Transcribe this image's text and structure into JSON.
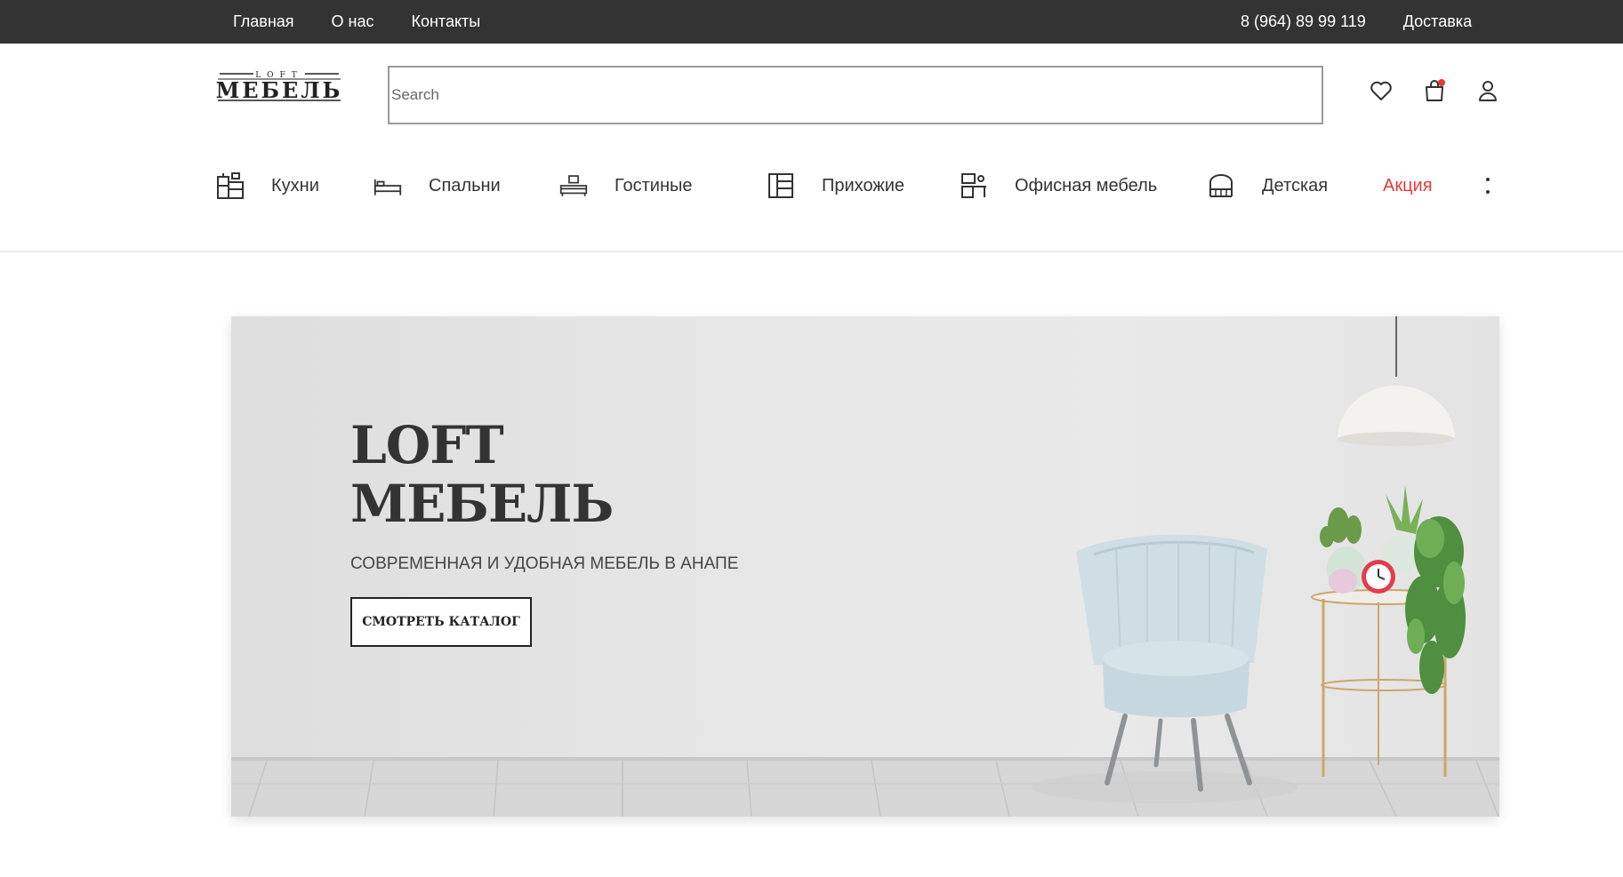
{
  "topbar": {
    "links": [
      "Главная",
      "О нас",
      "Контакты"
    ],
    "phone": "8 (964) 89 99 119",
    "delivery": "Доставка",
    "bg_color": "#333333"
  },
  "header": {
    "logo_alt": "LOFT МЕБЕЛЬ",
    "search_placeholder": "Search",
    "search_value": "",
    "icons": [
      "heart-icon",
      "cart-icon",
      "user-icon"
    ],
    "cart_badge_color": "#e53935"
  },
  "categories": [
    {
      "label": "Кухни",
      "icon": "kitchen-icon"
    },
    {
      "label": "Спальни",
      "icon": "bed-icon"
    },
    {
      "label": "Гостиные",
      "icon": "living-room-icon"
    },
    {
      "label": "Прихожие",
      "icon": "hallway-wardrobe-icon"
    },
    {
      "label": "Офисная мебель",
      "icon": "office-desk-icon"
    },
    {
      "label": "Детская",
      "icon": "crib-icon"
    },
    {
      "label": "Акция",
      "icon": ""
    }
  ],
  "promo_color": "#e53935",
  "hero": {
    "title_line1": "LOFT",
    "title_line2": "МЕБЕЛЬ",
    "subtitle": "СОВРЕМЕННАЯ И УДОБНАЯ МЕБЕЛЬ В АНАПЕ",
    "button_label": "СМОТРЕТЬ КАТАЛОГ"
  }
}
